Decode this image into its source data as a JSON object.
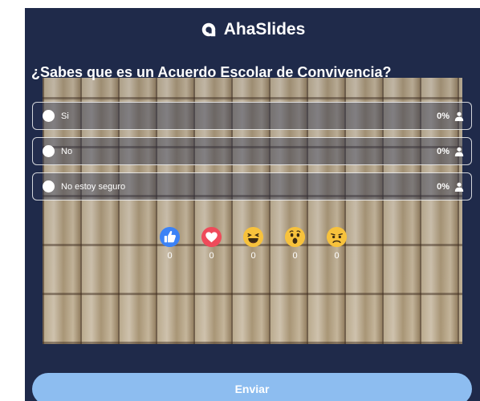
{
  "brand": {
    "name": "AhaSlides",
    "icon": "ahaslides-logo-icon"
  },
  "question": "¿Sabes que es un Acuerdo Escolar de Convivencia?",
  "options": [
    {
      "label": "Si",
      "percent": "0%",
      "icon": "user-icon"
    },
    {
      "label": "No",
      "percent": "0%",
      "icon": "user-icon"
    },
    {
      "label": "No estoy seguro",
      "percent": "0%",
      "icon": "user-icon"
    }
  ],
  "reactions": [
    {
      "icon": "thumbs-up-icon",
      "count": "0",
      "color": "#3b82f6"
    },
    {
      "icon": "heart-icon",
      "count": "0",
      "color": "#ef4a5a"
    },
    {
      "icon": "laughing-face-icon",
      "count": "0",
      "color": "#f7c23c"
    },
    {
      "icon": "surprised-face-icon",
      "count": "0",
      "color": "#f7c23c"
    },
    {
      "icon": "sad-face-icon",
      "count": "0",
      "color": "#f7c23c"
    }
  ],
  "submit": {
    "label": "Enviar"
  },
  "colors": {
    "background": "#1f2a4a",
    "button": "#8dbdf0"
  }
}
